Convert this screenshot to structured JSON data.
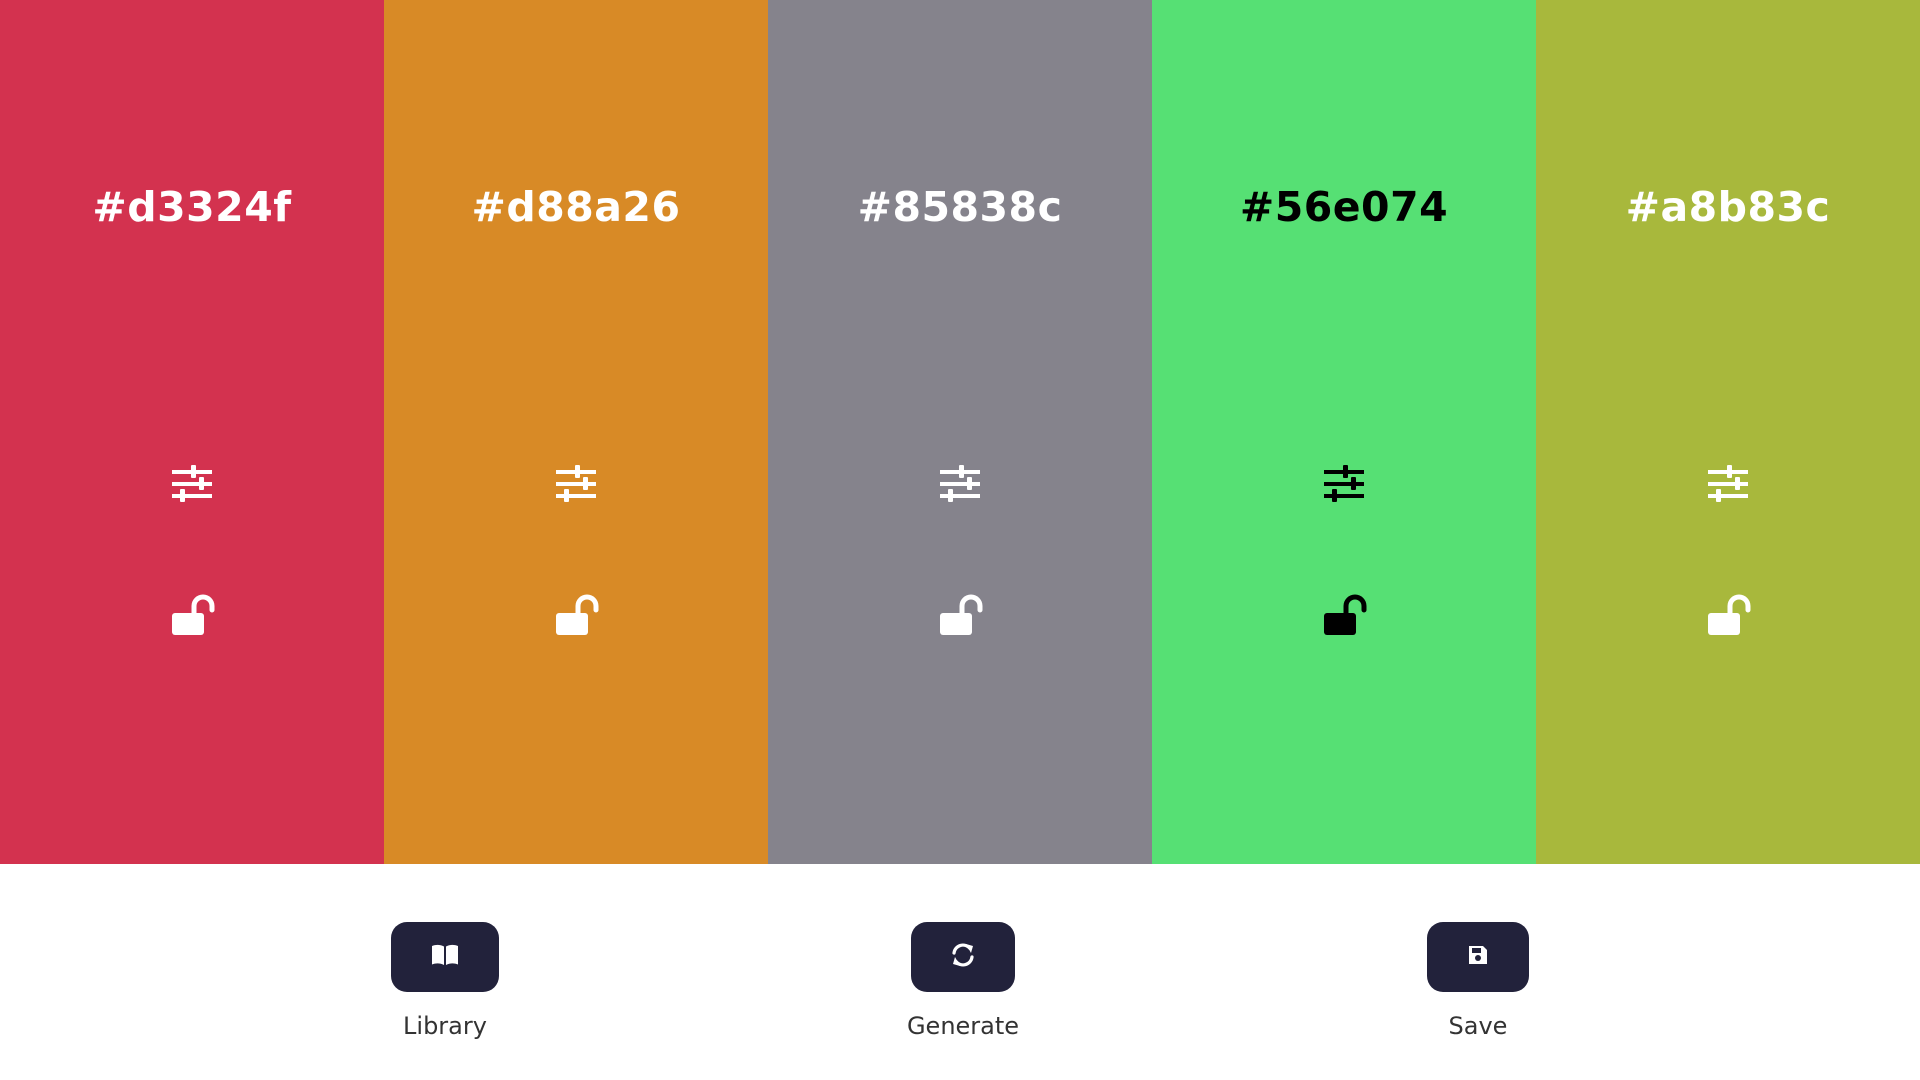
{
  "palette": {
    "swatches": [
      {
        "hex_label": "#d3324f",
        "color": "#d3324f",
        "text_color": "#ffffff",
        "adjust_icon": "sliders-icon",
        "lock_icon": "unlocked-icon",
        "locked": false
      },
      {
        "hex_label": "#d88a26",
        "color": "#d88a26",
        "text_color": "#ffffff",
        "adjust_icon": "sliders-icon",
        "lock_icon": "unlocked-icon",
        "locked": false
      },
      {
        "hex_label": "#85838c",
        "color": "#85838c",
        "text_color": "#ffffff",
        "adjust_icon": "sliders-icon",
        "lock_icon": "unlocked-icon",
        "locked": false
      },
      {
        "hex_label": "#56e074",
        "color": "#56e074",
        "text_color": "#000000",
        "adjust_icon": "sliders-icon",
        "lock_icon": "unlocked-icon",
        "locked": false
      },
      {
        "hex_label": "#a8b83c",
        "color": "#a8b83c",
        "text_color": "#ffffff",
        "adjust_icon": "sliders-icon",
        "lock_icon": "unlocked-icon",
        "locked": false
      }
    ]
  },
  "controls": {
    "button_color": "#22223b",
    "library": {
      "label": "Library",
      "icon": "book-open-icon"
    },
    "generate": {
      "label": "Generate",
      "icon": "refresh-icon"
    },
    "save": {
      "label": "Save",
      "icon": "floppy-disk-icon"
    }
  }
}
